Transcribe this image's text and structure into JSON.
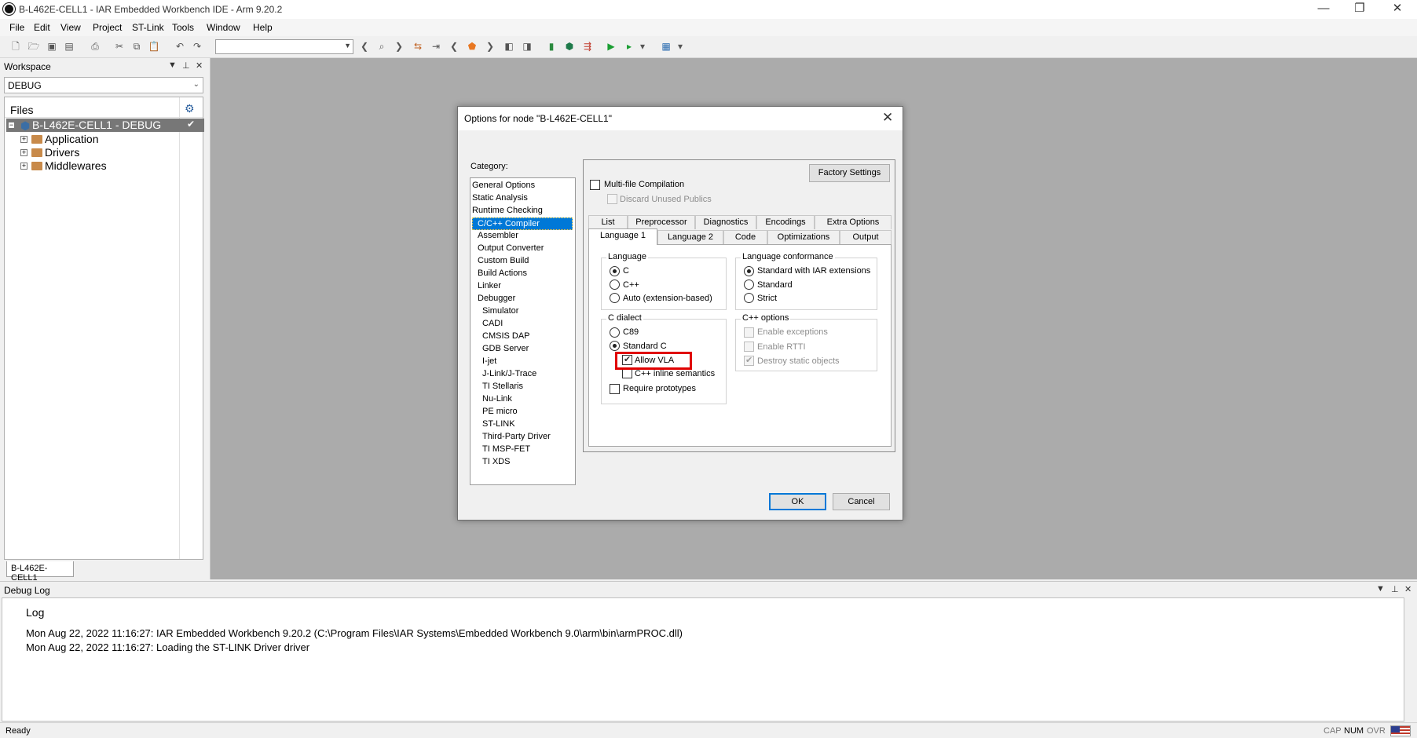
{
  "window": {
    "title": "B-L462E-CELL1 - IAR Embedded Workbench IDE - Arm 9.20.2",
    "minimize": "—",
    "restore": "❐",
    "close": "✕"
  },
  "menu": [
    "File",
    "Edit",
    "View",
    "Project",
    "ST-Link",
    "Tools",
    "Window",
    "Help"
  ],
  "workspace": {
    "title": "Workspace",
    "configuration": "DEBUG",
    "files_header": "Files",
    "project": "B-L462E-CELL1 - DEBUG",
    "project_check": "✔",
    "folders": [
      "Application",
      "Drivers",
      "Middlewares"
    ],
    "tab": "B-L462E-CELL1"
  },
  "dialog": {
    "title": "Options for node \"B-L462E-CELL1\"",
    "category_label": "Category:",
    "categories": [
      "General Options",
      "Static Analysis",
      "Runtime Checking",
      "C/C++ Compiler",
      "Assembler",
      "Output Converter",
      "Custom Build",
      "Build Actions",
      "Linker",
      "Debugger",
      "Simulator",
      "CADI",
      "CMSIS DAP",
      "GDB Server",
      "I-jet",
      "J-Link/J-Trace",
      "TI Stellaris",
      "Nu-Link",
      "PE micro",
      "ST-LINK",
      "Third-Party Driver",
      "TI MSP-FET",
      "TI XDS"
    ],
    "selected_category": "C/C++ Compiler",
    "factory_settings": "Factory Settings",
    "multi_file": "Multi-file Compilation",
    "discard_unused": "Discard Unused Publics",
    "tabs_row1": [
      "List",
      "Preprocessor",
      "Diagnostics",
      "Encodings",
      "Extra Options"
    ],
    "tabs_row2": [
      "Language 1",
      "Language 2",
      "Code",
      "Optimizations",
      "Output"
    ],
    "active_tab": "Language 1",
    "language": {
      "title": "Language",
      "options": [
        "C",
        "C++",
        "Auto (extension-based)"
      ],
      "selected": "C"
    },
    "conformance": {
      "title": "Language conformance",
      "options": [
        "Standard with IAR extensions",
        "Standard",
        "Strict"
      ],
      "selected": "Standard with IAR extensions"
    },
    "c_dialect": {
      "title": "C dialect",
      "options": [
        "C89",
        "Standard C"
      ],
      "selected": "Standard C",
      "allow_vla": "Allow VLA",
      "inline_semantics": "C++ inline semantics",
      "require_prototypes": "Require prototypes"
    },
    "cpp_options": {
      "title": "C++ options",
      "options": [
        "Enable exceptions",
        "Enable RTTI",
        "Destroy static objects"
      ]
    },
    "ok": "OK",
    "cancel": "Cancel"
  },
  "log": {
    "title": "Debug Log",
    "column": "Log",
    "lines": [
      "Mon Aug 22, 2022 11:16:27: IAR Embedded Workbench 9.20.2 (C:\\Program Files\\IAR Systems\\Embedded Workbench 9.0\\arm\\bin\\armPROC.dll)",
      "Mon Aug 22, 2022 11:16:27: Loading the ST-LINK Driver driver"
    ]
  },
  "status": {
    "text": "Ready",
    "indicators": [
      "CAP",
      "NUM",
      "OVR"
    ]
  },
  "colors": {
    "selection": "#0078d7",
    "highlight_box": "#e00000",
    "mdi_background": "#ababab"
  }
}
